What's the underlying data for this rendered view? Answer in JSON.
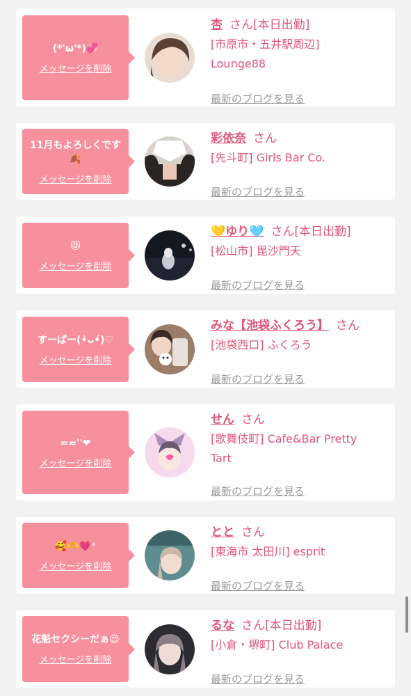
{
  "delete_label": "メッセージを削除",
  "blog_label": "最新のブログを見る",
  "san_label": "さん",
  "cards": [
    {
      "message": "(*'ω'*)💞",
      "name": "杏",
      "status": "[本日出勤]",
      "shop": "[市原市・五井駅周辺] Lounge88"
    },
    {
      "message": "11月もよろしくです🍂",
      "name": "彩依奈",
      "status": "",
      "shop": "[先斗町] Girls Bar Co."
    },
    {
      "message": "😻",
      "name": "💛ゆり🩵",
      "status": "[本日出勤]",
      "shop": "[松山市] 毘沙門天"
    },
    {
      "message": "すーぱー(•̀ᴗ•́)♡",
      "name": "みな【池袋ふくろう】",
      "status": "",
      "shop": "[池袋西口] ふくろう"
    },
    {
      "message": "≂≂''❤",
      "name": "せん",
      "status": "",
      "shop": "[歌舞伎町] Cafe&Bar Pretty Tart"
    },
    {
      "message": "🥰🫶💗⁺",
      "name": "とと",
      "status": "",
      "shop": "[東海市 太田川] esprit"
    },
    {
      "message": "花魁セクシーだぁ😍",
      "name": "るな",
      "status": "[本日出勤]",
      "shop": "[小倉・堺町] Club Palace"
    }
  ]
}
